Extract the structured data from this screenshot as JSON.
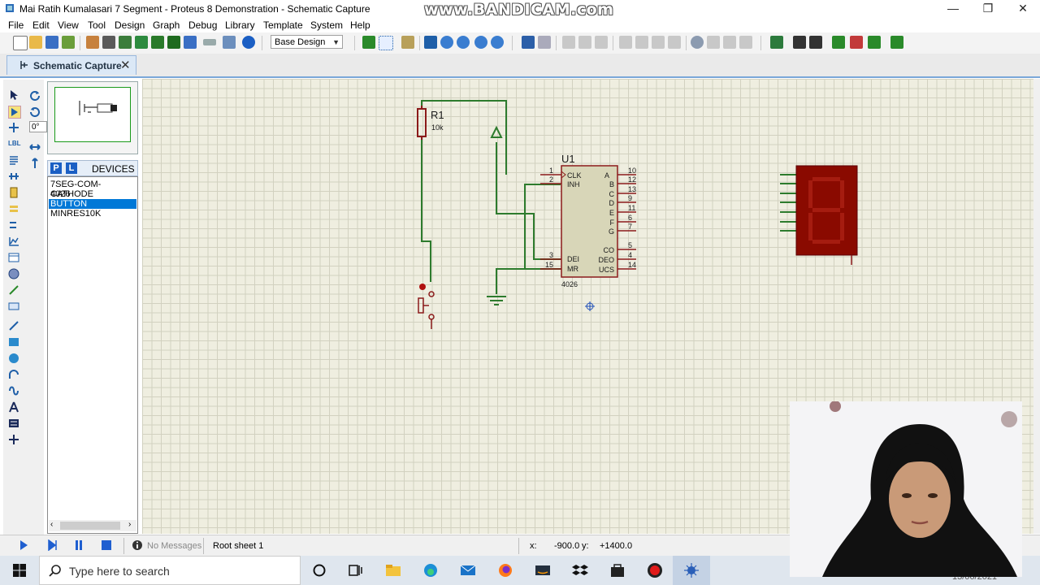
{
  "window": {
    "title": "Mai Ratih Kumalasari 7 Segment - Proteus 8 Demonstration - Schematic Capture",
    "watermark": "www.BANDICAM.com",
    "controls": {
      "minimize": "—",
      "maximize": "❐",
      "close": "✕"
    }
  },
  "menu": [
    "File",
    "Edit",
    "View",
    "Tool",
    "Design",
    "Graph",
    "Debug",
    "Library",
    "Template",
    "System",
    "Help"
  ],
  "toolbar": {
    "layer_select": "Base Design"
  },
  "tab": {
    "label": "Schematic Capture",
    "close": "✕"
  },
  "left_tools": {
    "zoom_angle": "0°",
    "label_tool": "LBL"
  },
  "devices": {
    "header": "DEVICES",
    "p_button": "P",
    "l_button": "L",
    "items": [
      {
        "label": "7SEG-COM-CATHODE",
        "selected": false
      },
      {
        "label": "4026",
        "selected": false
      },
      {
        "label": "BUTTON",
        "selected": true
      },
      {
        "label": "MINRES10K",
        "selected": false
      }
    ]
  },
  "schematic": {
    "resistor": {
      "ref": "R1",
      "value": "10k"
    },
    "chip": {
      "ref": "U1",
      "part": "4026",
      "left_pins": [
        {
          "num": "1",
          "name": "CLK"
        },
        {
          "num": "2",
          "name": "INH"
        },
        {
          "num": "3",
          "name": "DEI"
        },
        {
          "num": "15",
          "name": "MR"
        }
      ],
      "right_pins": [
        {
          "num": "10",
          "name": "A"
        },
        {
          "num": "12",
          "name": "B"
        },
        {
          "num": "13",
          "name": "C"
        },
        {
          "num": "9",
          "name": "D"
        },
        {
          "num": "11",
          "name": "E"
        },
        {
          "num": "6",
          "name": "F"
        },
        {
          "num": "7",
          "name": "G"
        },
        {
          "num": "5",
          "name": "CO"
        },
        {
          "num": "4",
          "name": "DEO"
        },
        {
          "num": "14",
          "name": "UCS"
        }
      ]
    },
    "display_digit": "8"
  },
  "status": {
    "messages": "No Messages",
    "sheet": "Root sheet 1",
    "x_label": "x:",
    "x_value": "-900.0",
    "y_label": "y:",
    "y_value": "+1400.0"
  },
  "taskbar": {
    "search_placeholder": "Type here to search",
    "date": "13/06/2021"
  },
  "colors": {
    "wire": "#2d7b2d",
    "component": "#8b1a1a",
    "chip_fill": "#d8d6b8",
    "canvas": "#efeee0",
    "selection": "#0078d7",
    "segment_display": "#8a0a00"
  }
}
